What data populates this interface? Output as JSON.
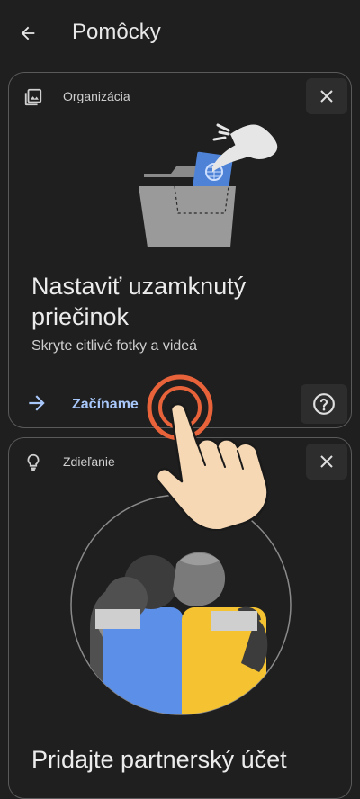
{
  "header": {
    "title": "Pomôcky"
  },
  "cards": [
    {
      "category": "Organizácia",
      "title": "Nastaviť uzamknutý priečinok",
      "subtitle": "Skryte citlivé fotky a videá",
      "action_label": "Začíname"
    },
    {
      "category": "Zdieľanie",
      "title": "Pridajte partnerský účet"
    }
  ],
  "colors": {
    "background": "#1f1f1f",
    "accent": "#a8c7fa",
    "tap_ring": "#e8633a"
  }
}
